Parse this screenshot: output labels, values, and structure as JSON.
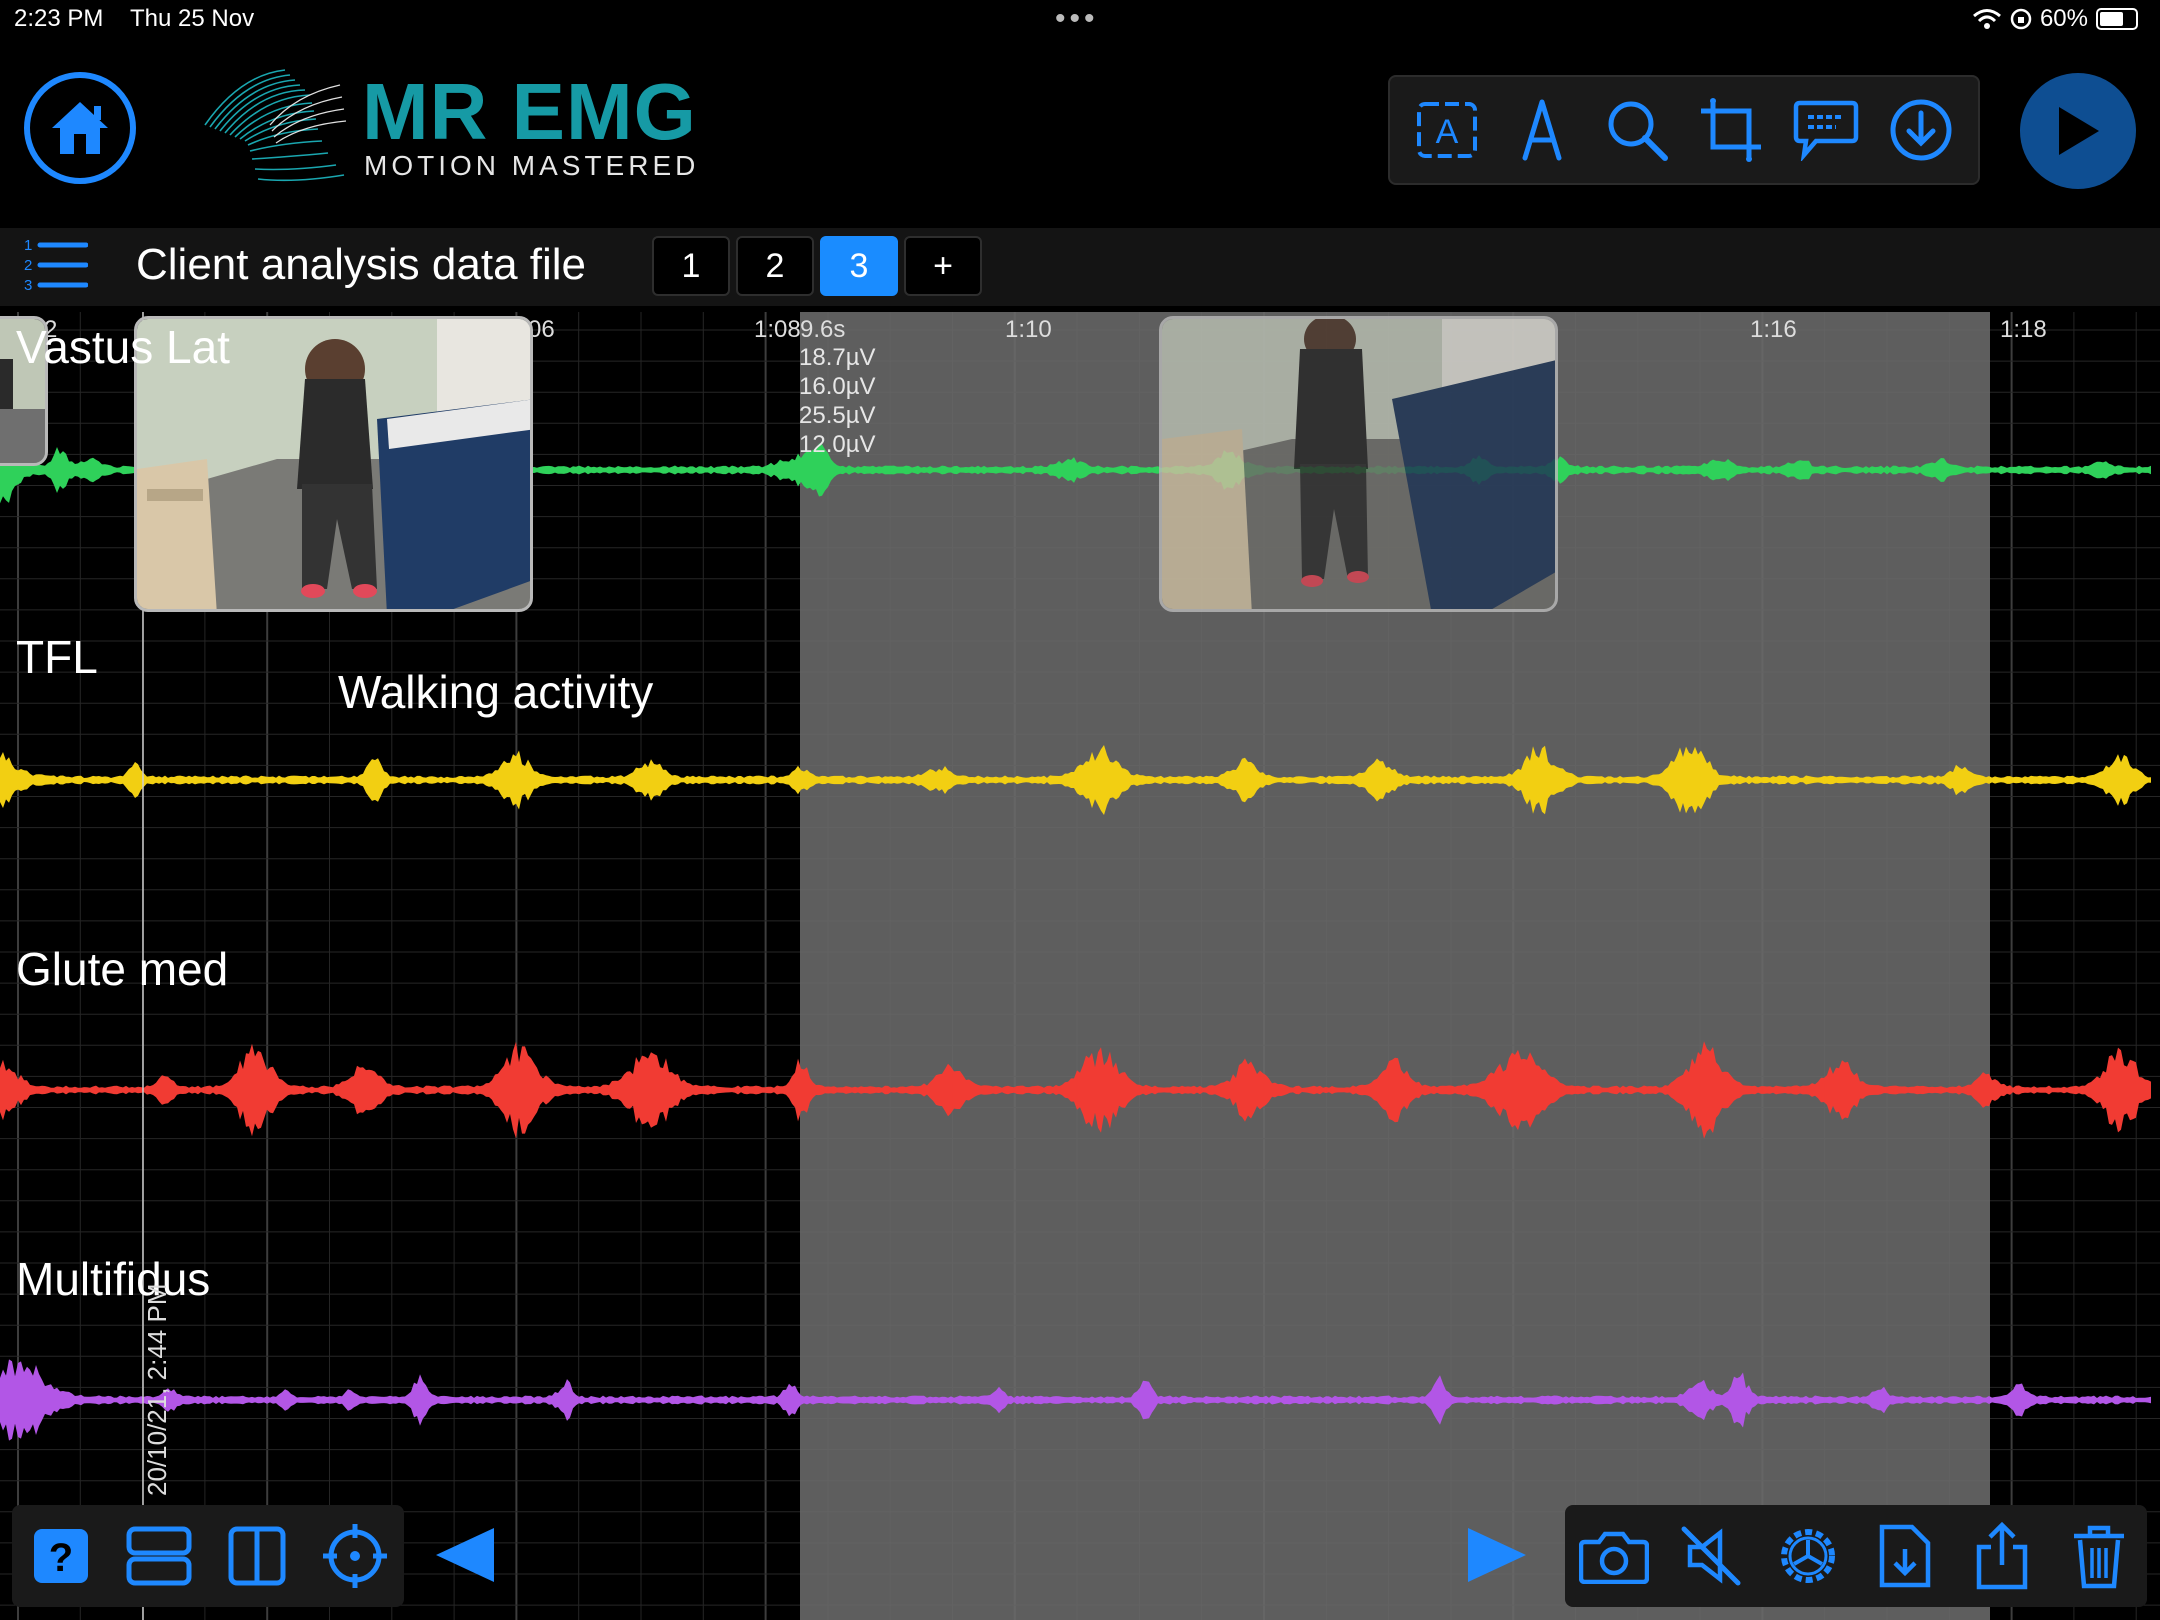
{
  "status_bar": {
    "time": "2:23 PM",
    "date": "Thu 25 Nov",
    "battery": "60%",
    "icons": [
      "wifi-icon",
      "orientation-lock-icon",
      "battery-icon"
    ]
  },
  "header": {
    "brand_title": "MR EMG",
    "brand_tagline": "MOTION MASTERED",
    "tools": [
      "text-box-icon",
      "pen-icon",
      "search-icon",
      "crop-icon",
      "comment-icon",
      "download-icon"
    ]
  },
  "file_bar": {
    "title": "Client analysis data file",
    "tabs": [
      {
        "label": "1",
        "active": false
      },
      {
        "label": "2",
        "active": false
      },
      {
        "label": "3",
        "active": true
      },
      {
        "label": "+",
        "active": false
      }
    ]
  },
  "chart": {
    "ticks": {
      "t_a": "2",
      "t_b": "06",
      "t_c": "1:08",
      "t_d": "1:10",
      "t_e": "1:16",
      "t_f": "1:18"
    },
    "cursor": {
      "time": "9.6s",
      "values": [
        "18.7µV",
        "16.0µV",
        "25.5µV",
        "12.0µV"
      ]
    },
    "selection": {
      "start": "1:08",
      "end": "1:18"
    },
    "annotation": "Walking activity",
    "timestamp": "20/10/21, 2:44 PM",
    "channels": [
      {
        "name": "Vastus Lat",
        "color": "#2fd15a"
      },
      {
        "name": "TFL",
        "color": "#f2cf12"
      },
      {
        "name": "Glute med",
        "color": "#f13b33"
      },
      {
        "name": "Multifidus",
        "color": "#b256e6"
      }
    ]
  },
  "bottom_toolbar": {
    "left": [
      "help-icon",
      "stacked-view-icon",
      "split-view-icon",
      "crosshair-icon"
    ],
    "nav": [
      "previous-arrow-icon",
      "next-arrow-icon"
    ],
    "right": [
      "camera-icon",
      "mute-icon",
      "settings-gear-icon",
      "export-file-icon",
      "share-icon",
      "trash-icon"
    ]
  },
  "colors": {
    "accent": "#1a8cff",
    "brand_teal": "#169aa5",
    "selection": "#6b6b6b"
  }
}
